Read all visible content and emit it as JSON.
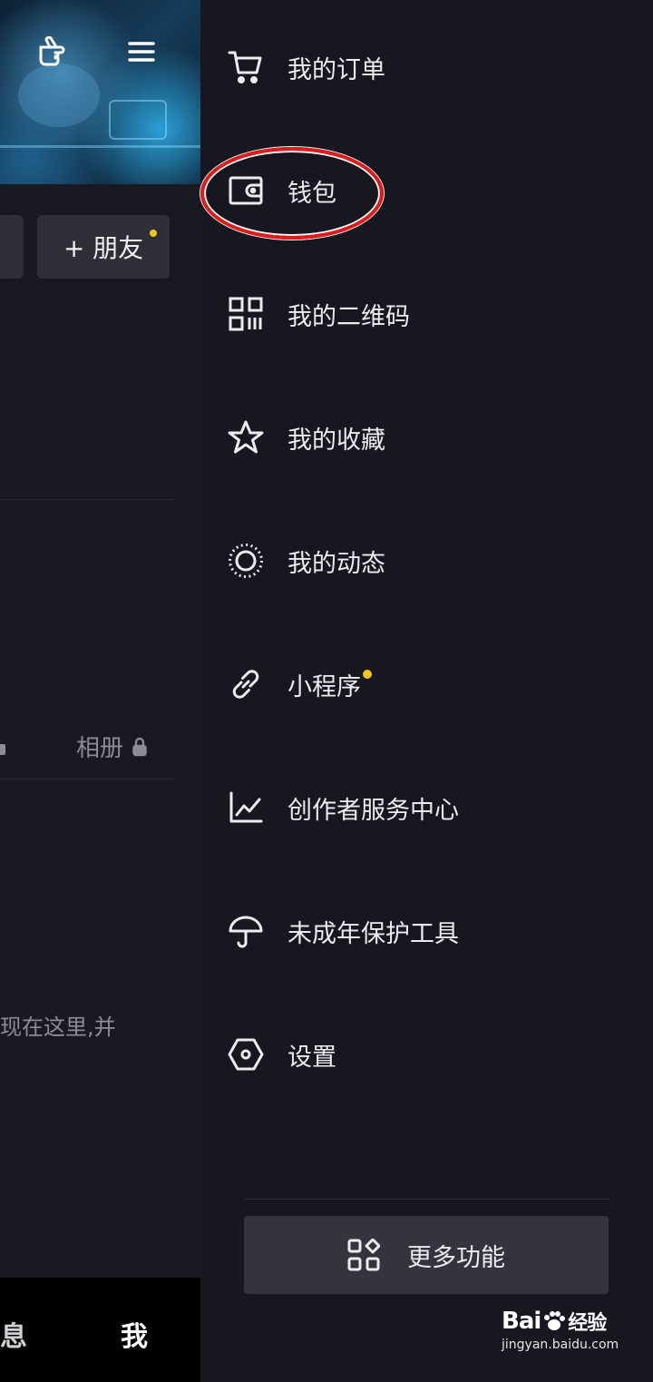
{
  "left_pane": {
    "add_friend_label": "+ 朋友",
    "album_label": "相册",
    "hint_text": "现在这里,并",
    "bottom_tabs": {
      "messages_partial": "消息",
      "me": "我"
    }
  },
  "drawer": {
    "items": [
      {
        "label": "我的订单",
        "icon": "cart-icon"
      },
      {
        "label": "钱包",
        "icon": "wallet-icon"
      },
      {
        "label": "我的二维码",
        "icon": "qrcode-icon"
      },
      {
        "label": "我的收藏",
        "icon": "star-icon"
      },
      {
        "label": "我的动态",
        "icon": "dotted-circle-icon"
      },
      {
        "label": "小程序",
        "icon": "link-icon",
        "badge": true
      },
      {
        "label": "创作者服务中心",
        "icon": "chart-icon"
      },
      {
        "label": "未成年保护工具",
        "icon": "umbrella-icon"
      },
      {
        "label": "设置",
        "icon": "hexagon-settings-icon"
      }
    ],
    "more_button_label": "更多功能"
  },
  "watermark": {
    "brand": "Bai",
    "brand_cn": "经验",
    "url": "jingyan.baidu.com"
  },
  "colors": {
    "background": "#16171f",
    "badge": "#f5c518",
    "highlight": "#e31a1a",
    "button": "#33343c"
  }
}
